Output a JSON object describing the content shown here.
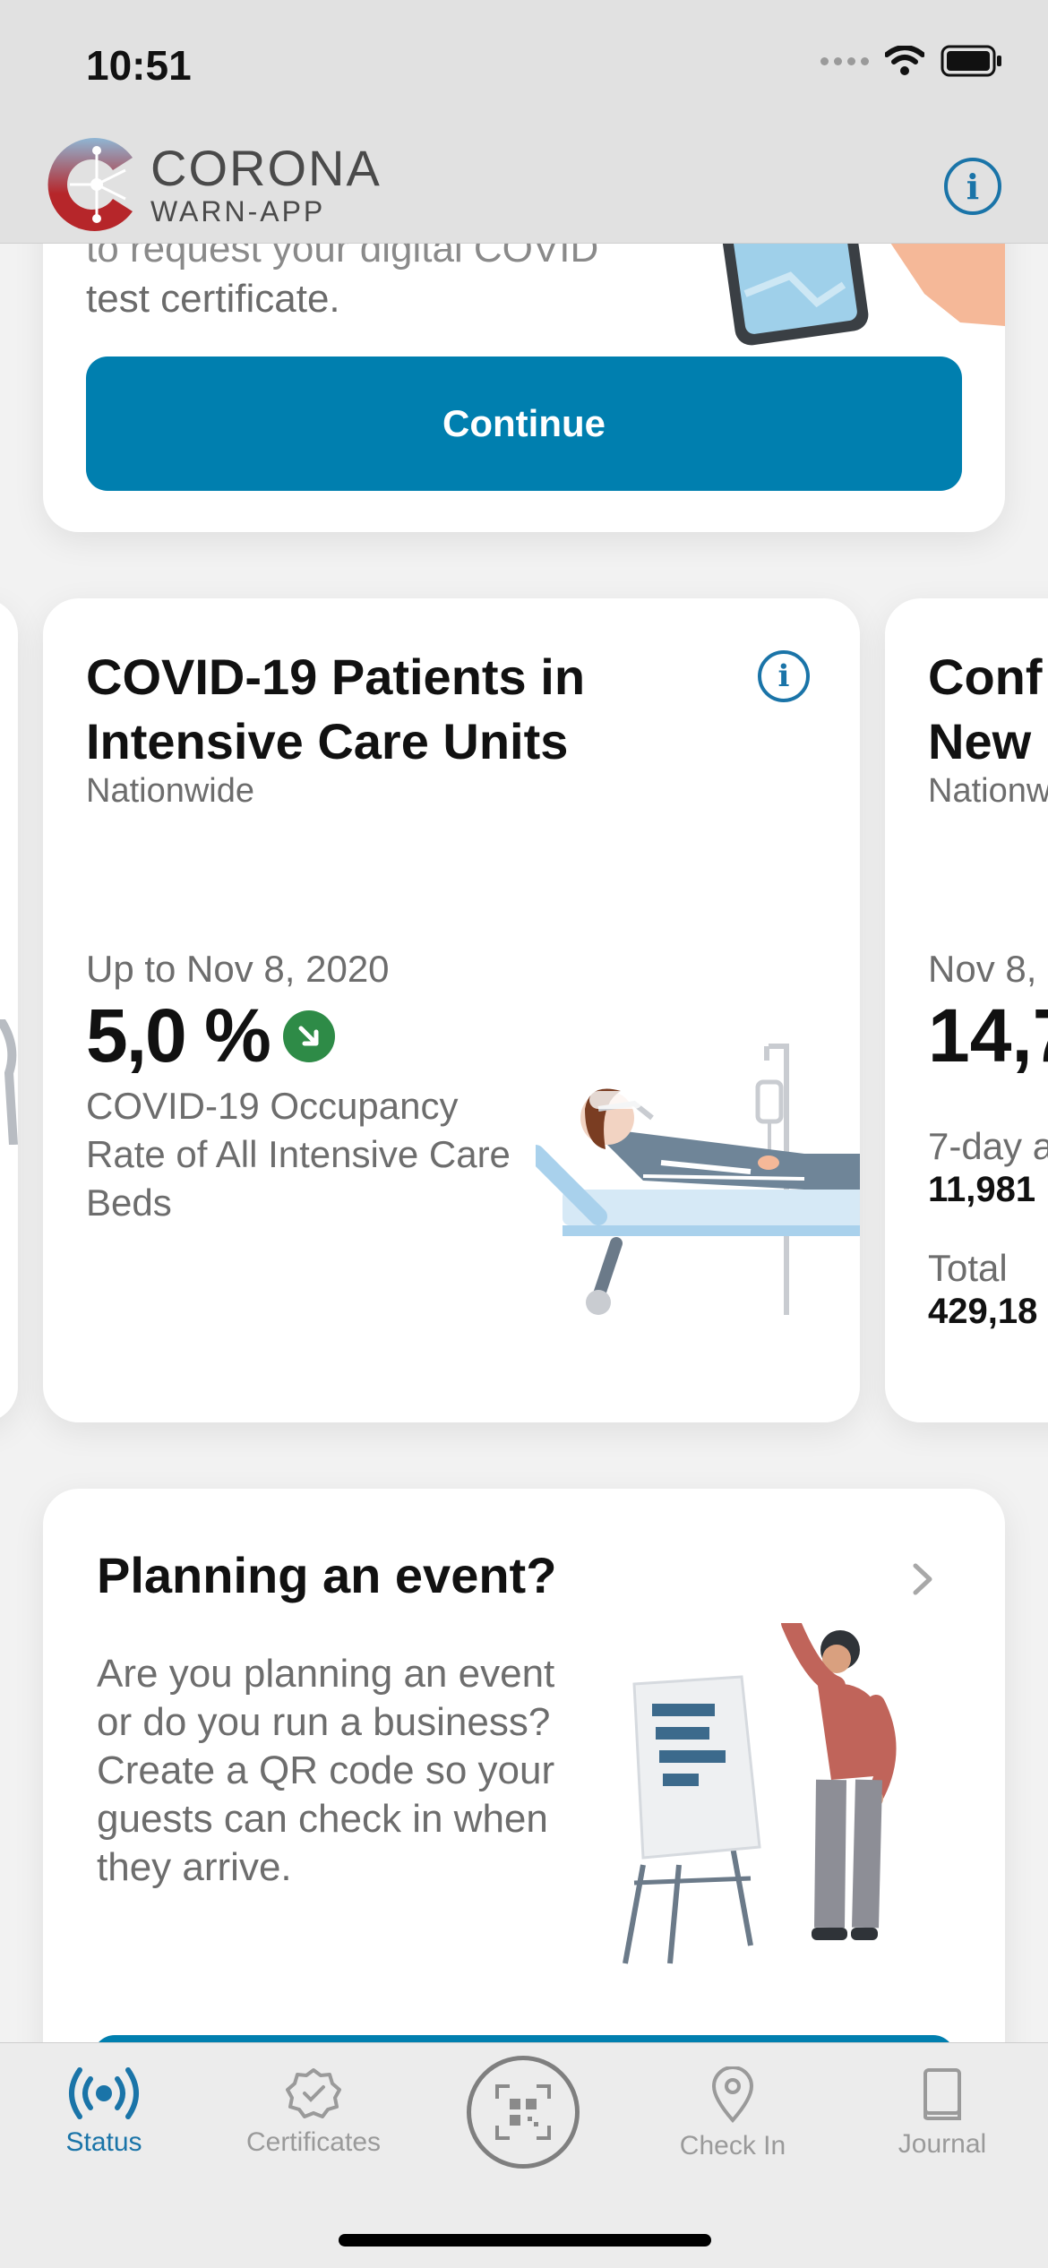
{
  "status_bar": {
    "time": "10:51"
  },
  "header": {
    "app_name_line1": "CORONA",
    "app_name_line2": "WARN-APP",
    "info_icon": "info-icon"
  },
  "top_card": {
    "partial_text_line1": "to request your digital COVID",
    "partial_text_line2": "test certificate.",
    "button_label": "Continue"
  },
  "stats": {
    "icu": {
      "title": "COVID-19 Patients in Intensive Care Units",
      "region": "Nationwide",
      "date": "Up to Nov 8, 2020",
      "value": "5,0 %",
      "trend": "down",
      "description": "COVID-19 Occupancy Rate of All Intensive Care Beds"
    },
    "next": {
      "title_line1": "Conf",
      "title_line2": "New",
      "region": "Nationw",
      "date": "Nov 8,",
      "value": "14,7",
      "label1": "7-day a",
      "value1": "11,981",
      "label2": "Total",
      "value2": "429,18"
    }
  },
  "event_card": {
    "title": "Planning an event?",
    "description": "Are you planning an event or do you run a business? Create a QR code so your guests can check in when they arrive."
  },
  "tabbar": {
    "tabs": [
      {
        "label": "Status",
        "icon": "broadcast-icon",
        "active": true
      },
      {
        "label": "Certificates",
        "icon": "certificate-icon",
        "active": false
      },
      {
        "label": "",
        "icon": "qr-scan-icon",
        "active": false
      },
      {
        "label": "Check In",
        "icon": "location-pin-icon",
        "active": false
      },
      {
        "label": "Journal",
        "icon": "book-icon",
        "active": false
      }
    ]
  },
  "colors": {
    "accent": "#007faf",
    "trend_down": "#2e8b47",
    "info": "#1a74a8"
  }
}
